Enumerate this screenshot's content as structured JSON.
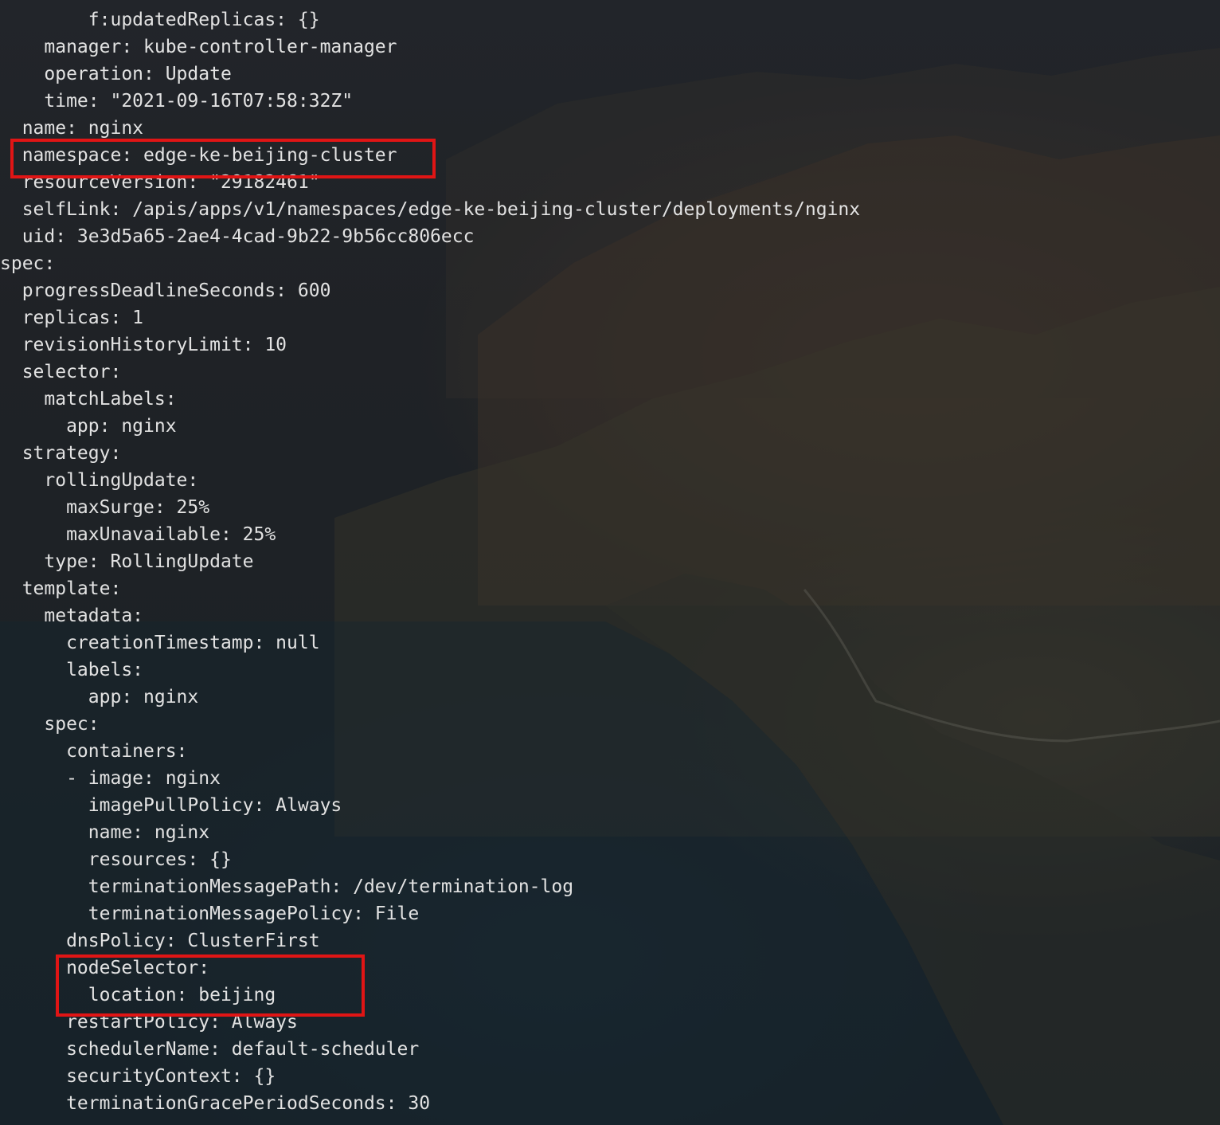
{
  "terminal": {
    "lines": [
      "        f:updatedReplicas: {}",
      "    manager: kube-controller-manager",
      "    operation: Update",
      "    time: \"2021-09-16T07:58:32Z\"",
      "  name: nginx",
      "  namespace: edge-ke-beijing-cluster",
      "  resourceVersion: \"29182461\"",
      "  selfLink: /apis/apps/v1/namespaces/edge-ke-beijing-cluster/deployments/nginx",
      "  uid: 3e3d5a65-2ae4-4cad-9b22-9b56cc806ecc",
      "spec:",
      "  progressDeadlineSeconds: 600",
      "  replicas: 1",
      "  revisionHistoryLimit: 10",
      "  selector:",
      "    matchLabels:",
      "      app: nginx",
      "  strategy:",
      "    rollingUpdate:",
      "      maxSurge: 25%",
      "      maxUnavailable: 25%",
      "    type: RollingUpdate",
      "  template:",
      "    metadata:",
      "      creationTimestamp: null",
      "      labels:",
      "        app: nginx",
      "    spec:",
      "      containers:",
      "      - image: nginx",
      "        imagePullPolicy: Always",
      "        name: nginx",
      "        resources: {}",
      "        terminationMessagePath: /dev/termination-log",
      "        terminationMessagePolicy: File",
      "      dnsPolicy: ClusterFirst",
      "      nodeSelector:",
      "        location: beijing",
      "      restartPolicy: Always",
      "      schedulerName: default-scheduler",
      "      securityContext: {}",
      "      terminationGracePeriodSeconds: 30"
    ]
  },
  "highlights": [
    {
      "name": "highlight-namespace",
      "color": "#e01515"
    },
    {
      "name": "highlight-node-selector",
      "color": "#e01515"
    }
  ],
  "colors": {
    "text": "#e2e2e2",
    "background": "#1c2024",
    "highlight": "#e01515"
  }
}
